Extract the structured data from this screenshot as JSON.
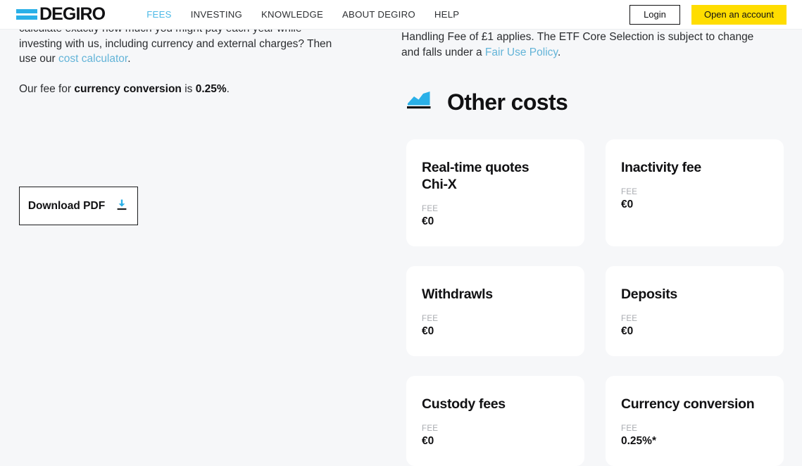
{
  "header": {
    "logo": {
      "text": "DEGIRO",
      "bar_color": "#2ab0e8"
    },
    "nav": [
      {
        "label": "FEES",
        "active": true
      },
      {
        "label": "INVESTING",
        "active": false
      },
      {
        "label": "KNOWLEDGE",
        "active": false
      },
      {
        "label": "ABOUT DEGIRO",
        "active": false
      },
      {
        "label": "HELP",
        "active": false
      }
    ],
    "login_label": "Login",
    "open_account_label": "Open an account",
    "accent_yellow": "#ffdd00",
    "accent_blue": "#4cb9e7"
  },
  "left": {
    "paragraph_clipped": {
      "line1": "calculate exactly how much you might pay each year while",
      "line2": "investing with us, including currency and external charges? Then",
      "line3_prefix": "use our ",
      "link_label": "cost calculator",
      "line3_suffix": "."
    },
    "paragraph_fee": {
      "prefix": "Our fee for ",
      "bold1": "currency conversion",
      "middle": " is ",
      "bold2": "0.25%",
      "suffix": "."
    },
    "download_button": {
      "label": "Download PDF",
      "icon": "download-arrow-icon"
    }
  },
  "right": {
    "paragraph": {
      "text_before_link": "Handling Fee of £1 applies. The ETF Core Selection is subject to change and falls under a ",
      "link_label": "Fair Use Policy",
      "text_after_link": "."
    },
    "section": {
      "icon": "area-chart-icon",
      "title": "Other costs"
    },
    "cards": [
      {
        "title": "Real-time quotes\nChi-X",
        "fee_label": "FEE",
        "fee_value": "€0",
        "tall": true
      },
      {
        "title": "Inactivity fee",
        "fee_label": "FEE",
        "fee_value": "€0",
        "tall": false
      },
      {
        "title": "Withdrawls",
        "fee_label": "FEE",
        "fee_value": "€0",
        "tall": false
      },
      {
        "title": "Deposits",
        "fee_label": "FEE",
        "fee_value": "€0",
        "tall": false
      },
      {
        "title": "Custody fees",
        "fee_label": "FEE",
        "fee_value": "€0",
        "tall": false
      },
      {
        "title": "Currency conversion",
        "fee_label": "FEE",
        "fee_value": "0.25%*",
        "tall": false
      }
    ]
  }
}
